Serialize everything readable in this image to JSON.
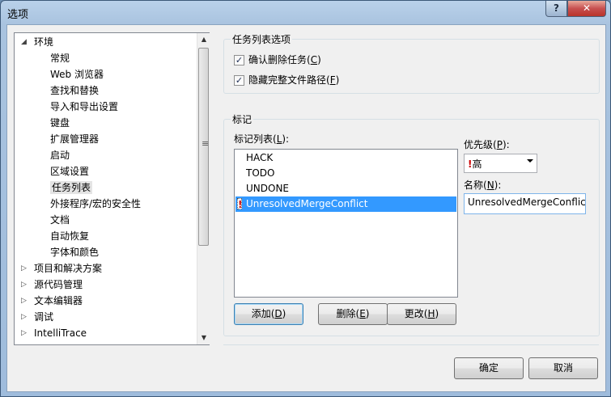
{
  "window": {
    "title": "选项",
    "help_glyph": "?",
    "close_glyph": "✕"
  },
  "tree": {
    "root_label": "环境",
    "root_expander": "◢",
    "children": [
      "常规",
      "Web 浏览器",
      "查找和替换",
      "导入和导出设置",
      "键盘",
      "扩展管理器",
      "启动",
      "区域设置",
      "任务列表",
      "外接程序/宏的安全性",
      "文档",
      "自动恢复",
      "字体和颜色"
    ],
    "selected_child": "任务列表",
    "collapsed_nodes": [
      "项目和解决方案",
      "源代码管理",
      "文本编辑器",
      "调试",
      "IntelliTrace"
    ],
    "collapsed_expander": "▷",
    "scroll_up": "▲",
    "scroll_down": "▼",
    "scroll_grip": "≡"
  },
  "task_options": {
    "title": "任务列表选项",
    "confirm_delete": {
      "label": "确认删除任务(",
      "mnemonic": "C",
      "suffix": ")",
      "checked": true
    },
    "hide_path": {
      "label": "隐藏完整文件路径(",
      "mnemonic": "F",
      "suffix": ")",
      "checked": true
    },
    "check_glyph": "✓"
  },
  "tokens": {
    "title": "标记",
    "list_label": {
      "text": "标记列表(",
      "mnemonic": "L",
      "suffix": "):"
    },
    "items": [
      "HACK",
      "TODO",
      "UNDONE",
      "UnresolvedMergeConflict"
    ],
    "selected_item": "UnresolvedMergeConflict",
    "flag_glyph": "!",
    "priority_label": {
      "text": "优先级(",
      "mnemonic": "P",
      "suffix": "):"
    },
    "priority_value": "高",
    "priority_flag": "!",
    "name_label": {
      "text": "名称(",
      "mnemonic": "N",
      "suffix": "):"
    },
    "name_value": "UnresolvedMergeConflic",
    "add_button": {
      "text": "添加(",
      "mnemonic": "D",
      "suffix": ")"
    },
    "delete_button": {
      "text": "删除(",
      "mnemonic": "E",
      "suffix": ")"
    },
    "change_button": {
      "text": "更改(",
      "mnemonic": "H",
      "suffix": ")"
    }
  },
  "footer": {
    "ok_label": "确定",
    "cancel_label": "取消"
  },
  "colors": {
    "selection": "#3399ff",
    "titlebar": "#b9d1ea",
    "close_button": "#c75050"
  }
}
